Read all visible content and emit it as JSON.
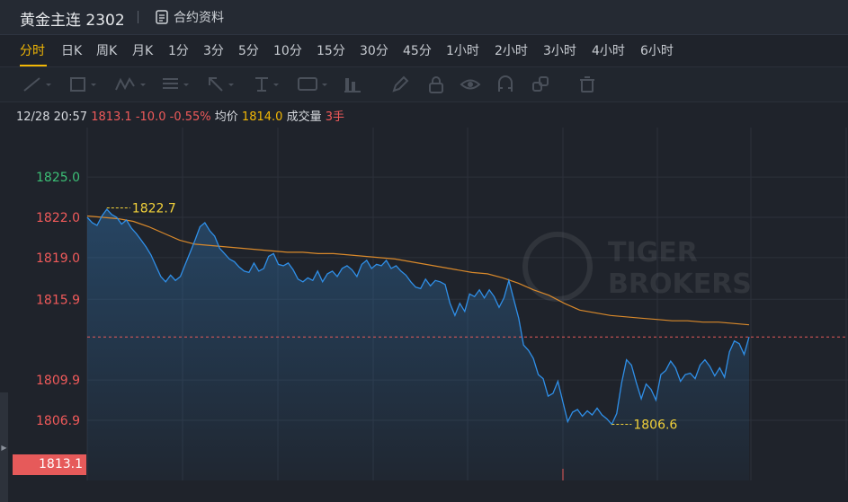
{
  "header": {
    "title": "黄金主连 2302",
    "doc_label": "合约资料"
  },
  "tabs": [
    {
      "label": "分时",
      "active": true
    },
    {
      "label": "日K"
    },
    {
      "label": "周K"
    },
    {
      "label": "月K"
    },
    {
      "label": "1分"
    },
    {
      "label": "3分"
    },
    {
      "label": "5分"
    },
    {
      "label": "10分"
    },
    {
      "label": "15分"
    },
    {
      "label": "30分"
    },
    {
      "label": "45分"
    },
    {
      "label": "1小时"
    },
    {
      "label": "2小时"
    },
    {
      "label": "3小时"
    },
    {
      "label": "4小时"
    },
    {
      "label": "6小时"
    }
  ],
  "info": {
    "time": "12/28 20:57",
    "price": "1813.1",
    "change": "-10.0",
    "change_pct": "-0.55%",
    "avg_label": "均价",
    "avg_value": "1814.0",
    "volume_label": "成交量",
    "volume_value": "3手"
  },
  "colors": {
    "background": "#1f232b",
    "accent": "#f2b705",
    "up": "#3cbf76",
    "down": "#f05a5a",
    "price_line": "#2f8fe8",
    "avg_line": "#d9892b"
  },
  "chart_data": {
    "type": "line",
    "y_ticks": [
      "1825.0",
      "1822.0",
      "1819.0",
      "1815.9",
      "1813.1",
      "1809.9",
      "1806.9"
    ],
    "current_price": "1813.1",
    "annotations": {
      "high": "1822.7",
      "low": "1806.6"
    },
    "watermark": [
      "TIGER",
      "BROKERS"
    ],
    "ylim": [
      1804.5,
      1827.8
    ],
    "series": [
      {
        "values": [
          1822.0,
          1821.6,
          1821.4,
          1822.1,
          1822.6,
          1822.2,
          1822.0,
          1821.5,
          1821.8,
          1821.2,
          1820.8,
          1820.3,
          1819.8,
          1819.2,
          1818.4,
          1817.6,
          1817.2,
          1817.7,
          1817.3,
          1817.6,
          1818.5,
          1819.4,
          1820.3,
          1821.3,
          1821.6,
          1821.0,
          1820.6,
          1819.7,
          1819.3,
          1818.9,
          1818.7,
          1818.3,
          1818.0,
          1817.9,
          1818.6,
          1818.0,
          1818.2,
          1819.1,
          1819.3,
          1818.5,
          1818.4,
          1818.6,
          1818.1,
          1817.4,
          1817.2,
          1817.5,
          1817.3,
          1818.0,
          1817.2,
          1817.8,
          1818.0,
          1817.6,
          1818.2,
          1818.4,
          1818.1,
          1817.6,
          1818.5,
          1818.8,
          1818.2,
          1818.5,
          1818.4,
          1818.8,
          1818.2,
          1818.4,
          1818.0,
          1817.7,
          1817.2,
          1816.8,
          1816.7,
          1817.4,
          1816.9,
          1817.3,
          1817.2,
          1817.0,
          1815.6,
          1814.7,
          1815.6,
          1815.0,
          1816.3,
          1816.1,
          1816.6,
          1816.0,
          1816.6,
          1816.1,
          1815.3,
          1816.0,
          1817.3,
          1815.9,
          1814.5,
          1812.5,
          1812.1,
          1811.5,
          1810.3,
          1810.0,
          1808.7,
          1808.9,
          1809.8,
          1808.3,
          1806.8,
          1807.5,
          1807.7,
          1807.2,
          1807.6,
          1807.3,
          1807.8,
          1807.3,
          1807.0,
          1806.6,
          1807.4,
          1809.7,
          1811.4,
          1811.0,
          1809.7,
          1808.5,
          1809.6,
          1809.2,
          1808.4,
          1810.3,
          1810.6,
          1811.3,
          1810.8,
          1809.8,
          1810.3,
          1810.4,
          1810.0,
          1811.0,
          1811.4,
          1810.9,
          1810.2,
          1810.8,
          1810.1,
          1812.0,
          1812.8,
          1812.6,
          1811.8,
          1813.1
        ]
      },
      {
        "values": [
          1822.1,
          1822.0,
          1821.9,
          1821.7,
          1821.3,
          1820.8,
          1820.3,
          1820.0,
          1819.9,
          1819.8,
          1819.7,
          1819.6,
          1819.5,
          1819.4,
          1819.4,
          1819.3,
          1819.3,
          1819.2,
          1819.1,
          1819.0,
          1818.9,
          1818.7,
          1818.5,
          1818.3,
          1818.1,
          1817.9,
          1817.8,
          1817.5,
          1817.1,
          1816.6,
          1816.2,
          1815.6,
          1815.1,
          1814.9,
          1814.7,
          1814.6,
          1814.5,
          1814.4,
          1814.3,
          1814.3,
          1814.2,
          1814.2,
          1814.1,
          1814.0
        ]
      }
    ]
  }
}
